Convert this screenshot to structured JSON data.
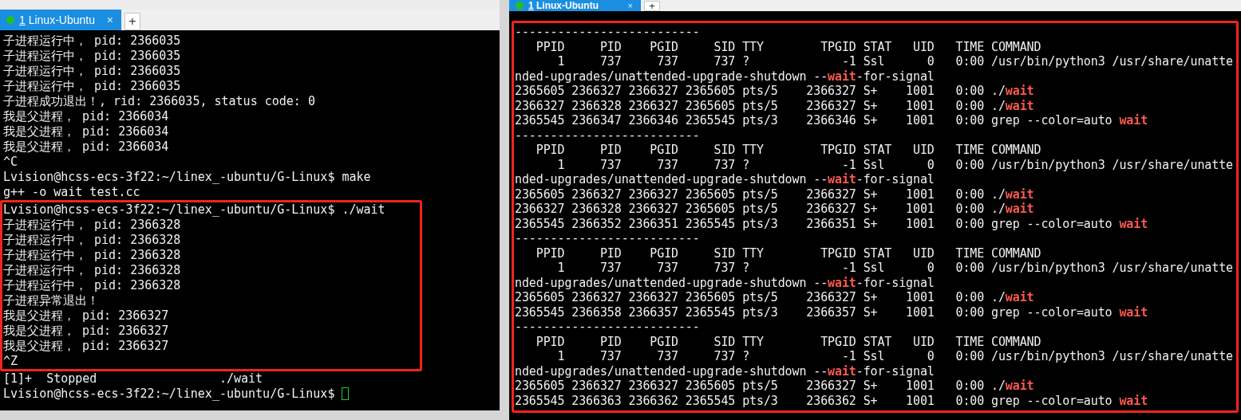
{
  "windows": [
    {
      "tab": {
        "number": "1",
        "label": "Linux-Ubuntu",
        "close": "×",
        "selected": true
      },
      "new_tab": "+",
      "blocks": [
        {
          "highlighted": false,
          "lines": [
            {
              "parts": [
                {
                  "text": "子进程运行中， pid: 2366035",
                  "kind": "plain"
                }
              ]
            },
            {
              "parts": [
                {
                  "text": "子进程运行中， pid: 2366035",
                  "kind": "plain"
                }
              ]
            },
            {
              "parts": [
                {
                  "text": "子进程运行中， pid: 2366035",
                  "kind": "plain"
                }
              ]
            },
            {
              "parts": [
                {
                  "text": "子进程运行中， pid: 2366035",
                  "kind": "plain"
                }
              ]
            },
            {
              "parts": [
                {
                  "text": "子进程成功退出！, rid: 2366035, status code: 0",
                  "kind": "plain"
                }
              ]
            },
            {
              "parts": [
                {
                  "text": "我是父进程， pid: 2366034",
                  "kind": "plain"
                }
              ]
            },
            {
              "parts": [
                {
                  "text": "我是父进程， pid: 2366034",
                  "kind": "plain"
                }
              ]
            },
            {
              "parts": [
                {
                  "text": "我是父进程， pid: 2366034",
                  "kind": "plain"
                }
              ]
            },
            {
              "parts": [
                {
                  "text": "^C",
                  "kind": "plain"
                }
              ]
            },
            {
              "parts": [
                {
                  "text": "Lvision@hcss-ecs-3f22:~/linex_-ubuntu/G-Linux$ make",
                  "kind": "plain"
                }
              ]
            },
            {
              "parts": [
                {
                  "text": "g++ -o wait test.cc",
                  "kind": "plain"
                }
              ]
            }
          ]
        },
        {
          "highlighted": true,
          "lines": [
            {
              "parts": [
                {
                  "text": "Lvision@hcss-ecs-3f22:~/linex_-ubuntu/G-Linux$ ./wait",
                  "kind": "plain"
                }
              ]
            },
            {
              "parts": [
                {
                  "text": "子进程运行中， pid: 2366328",
                  "kind": "plain"
                }
              ]
            },
            {
              "parts": [
                {
                  "text": "子进程运行中， pid: 2366328",
                  "kind": "plain"
                }
              ]
            },
            {
              "parts": [
                {
                  "text": "子进程运行中， pid: 2366328",
                  "kind": "plain"
                }
              ]
            },
            {
              "parts": [
                {
                  "text": "子进程运行中， pid: 2366328",
                  "kind": "plain"
                }
              ]
            },
            {
              "parts": [
                {
                  "text": "子进程运行中， pid: 2366328",
                  "kind": "plain"
                }
              ]
            },
            {
              "parts": [
                {
                  "text": "子进程异常退出！",
                  "kind": "plain"
                }
              ]
            },
            {
              "parts": [
                {
                  "text": "我是父进程， pid: 2366327",
                  "kind": "plain"
                }
              ]
            },
            {
              "parts": [
                {
                  "text": "我是父进程， pid: 2366327",
                  "kind": "plain"
                }
              ]
            },
            {
              "parts": [
                {
                  "text": "我是父进程， pid: 2366327",
                  "kind": "plain"
                }
              ]
            },
            {
              "parts": [
                {
                  "text": "^Z",
                  "kind": "plain"
                }
              ]
            }
          ]
        },
        {
          "highlighted": false,
          "lines": [
            {
              "parts": [
                {
                  "text": "[1]+  Stopped                 ./wait",
                  "kind": "plain"
                }
              ]
            },
            {
              "parts": [
                {
                  "text": "Lvision@hcss-ecs-3f22:~/linex_-ubuntu/G-Linux$",
                  "kind": "plain"
                }
              ],
              "cursor": true
            }
          ]
        }
      ]
    },
    {
      "tab": {
        "number": "1",
        "label": "Linux-Ubuntu",
        "close": "×",
        "selected": true
      },
      "new_tab": "+",
      "blocks": [
        {
          "highlighted": true,
          "lines": [
            {
              "parts": [
                {
                  "text": "--------------------------",
                  "kind": "plain"
                }
              ]
            },
            {
              "parts": [
                {
                  "text": "   PPID     PID    PGID     SID TTY        TPGID STAT   UID   TIME COMMAND",
                  "kind": "plain"
                }
              ]
            },
            {
              "parts": [
                {
                  "text": "      1     737     737     737 ?             -1 Ssl      0   0:00 /usr/bin/python3 /usr/share/unatte",
                  "kind": "plain"
                }
              ]
            },
            {
              "parts": [
                {
                  "text": "nded-upgrades/unattended-upgrade-shutdown --",
                  "kind": "plain"
                },
                {
                  "text": "wait",
                  "kind": "match"
                },
                {
                  "text": "-for-signal",
                  "kind": "plain"
                }
              ]
            },
            {
              "parts": [
                {
                  "text": "2365605 2366327 2366327 2365605 pts/5    2366327 S+    1001   0:00 ./",
                  "kind": "plain"
                },
                {
                  "text": "wait",
                  "kind": "match"
                }
              ]
            },
            {
              "parts": [
                {
                  "text": "2366327 2366328 2366327 2365605 pts/5    2366327 S+    1001   0:00 ./",
                  "kind": "plain"
                },
                {
                  "text": "wait",
                  "kind": "match"
                }
              ]
            },
            {
              "parts": [
                {
                  "text": "2365545 2366347 2366346 2365545 pts/3    2366346 S+    1001   0:00 grep --color=auto ",
                  "kind": "plain"
                },
                {
                  "text": "wait",
                  "kind": "match"
                }
              ]
            },
            {
              "parts": [
                {
                  "text": "--------------------------",
                  "kind": "plain"
                }
              ]
            },
            {
              "parts": [
                {
                  "text": "   PPID     PID    PGID     SID TTY        TPGID STAT   UID   TIME COMMAND",
                  "kind": "plain"
                }
              ]
            },
            {
              "parts": [
                {
                  "text": "      1     737     737     737 ?             -1 Ssl      0   0:00 /usr/bin/python3 /usr/share/unatte",
                  "kind": "plain"
                }
              ]
            },
            {
              "parts": [
                {
                  "text": "nded-upgrades/unattended-upgrade-shutdown --",
                  "kind": "plain"
                },
                {
                  "text": "wait",
                  "kind": "match"
                },
                {
                  "text": "-for-signal",
                  "kind": "plain"
                }
              ]
            },
            {
              "parts": [
                {
                  "text": "2365605 2366327 2366327 2365605 pts/5    2366327 S+    1001   0:00 ./",
                  "kind": "plain"
                },
                {
                  "text": "wait",
                  "kind": "match"
                }
              ]
            },
            {
              "parts": [
                {
                  "text": "2366327 2366328 2366327 2365605 pts/5    2366327 S+    1001   0:00 ./",
                  "kind": "plain"
                },
                {
                  "text": "wait",
                  "kind": "match"
                }
              ]
            },
            {
              "parts": [
                {
                  "text": "2365545 2366352 2366351 2365545 pts/3    2366351 S+    1001   0:00 grep --color=auto ",
                  "kind": "plain"
                },
                {
                  "text": "wait",
                  "kind": "match"
                }
              ]
            },
            {
              "parts": [
                {
                  "text": "--------------------------",
                  "kind": "plain"
                }
              ]
            },
            {
              "parts": [
                {
                  "text": "   PPID     PID    PGID     SID TTY        TPGID STAT   UID   TIME COMMAND",
                  "kind": "plain"
                }
              ]
            },
            {
              "parts": [
                {
                  "text": "      1     737     737     737 ?             -1 Ssl      0   0:00 /usr/bin/python3 /usr/share/unatte",
                  "kind": "plain"
                }
              ]
            },
            {
              "parts": [
                {
                  "text": "nded-upgrades/unattended-upgrade-shutdown --",
                  "kind": "plain"
                },
                {
                  "text": "wait",
                  "kind": "match"
                },
                {
                  "text": "-for-signal",
                  "kind": "plain"
                }
              ]
            },
            {
              "parts": [
                {
                  "text": "2365605 2366327 2366327 2365605 pts/5    2366327 S+    1001   0:00 ./",
                  "kind": "plain"
                },
                {
                  "text": "wait",
                  "kind": "match"
                }
              ]
            },
            {
              "parts": [
                {
                  "text": "2365545 2366358 2366357 2365545 pts/3    2366357 S+    1001   0:00 grep --color=auto ",
                  "kind": "plain"
                },
                {
                  "text": "wait",
                  "kind": "match"
                }
              ]
            },
            {
              "parts": [
                {
                  "text": "--------------------------",
                  "kind": "plain"
                }
              ]
            },
            {
              "parts": [
                {
                  "text": "   PPID     PID    PGID     SID TTY        TPGID STAT   UID   TIME COMMAND",
                  "kind": "plain"
                }
              ]
            },
            {
              "parts": [
                {
                  "text": "      1     737     737     737 ?             -1 Ssl      0   0:00 /usr/bin/python3 /usr/share/unatte",
                  "kind": "plain"
                }
              ]
            },
            {
              "parts": [
                {
                  "text": "nded-upgrades/unattended-upgrade-shutdown --",
                  "kind": "plain"
                },
                {
                  "text": "wait",
                  "kind": "match"
                },
                {
                  "text": "-for-signal",
                  "kind": "plain"
                }
              ]
            },
            {
              "parts": [
                {
                  "text": "2365605 2366327 2366327 2365605 pts/5    2366327 S+    1001   0:00 ./",
                  "kind": "plain"
                },
                {
                  "text": "wait",
                  "kind": "match"
                }
              ]
            },
            {
              "parts": [
                {
                  "text": "2365545 2366363 2366362 2365545 pts/3    2366362 S+    1001   0:00 grep --color=auto ",
                  "kind": "plain"
                },
                {
                  "text": "wait",
                  "kind": "match"
                }
              ]
            }
          ]
        }
      ]
    }
  ]
}
